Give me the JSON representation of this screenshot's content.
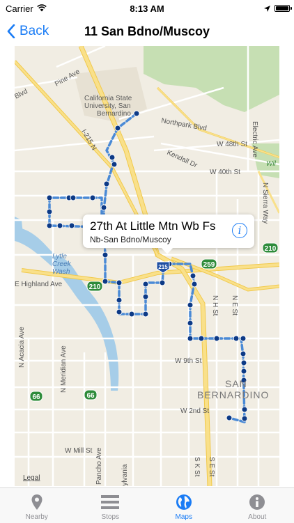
{
  "status_bar": {
    "carrier": "Carrier",
    "time": "8:13 AM",
    "battery_level": 1.0
  },
  "nav": {
    "back_label": "Back",
    "title": "11 San Bdno/Muscoy"
  },
  "map": {
    "labels": {
      "pine_ave": "Pine Ave",
      "csu": "California State",
      "csu2": "University, San",
      "csu3": "Bernardino",
      "northpark": "Northpark Blvd",
      "w48": "W 48th St",
      "w40": "W 40th St",
      "kendall": "Kendall Dr",
      "electric": "Electric Ave",
      "i215": "I-215 N",
      "sierra": "N Sierra Way",
      "lytle1": "Lytle",
      "lytle2": "Creek",
      "lytle3": "Wash",
      "highland": "E Highland Ave",
      "nh": "N H St",
      "ne": "N E St",
      "w9": "W 9th St",
      "san_bern1": "SAN",
      "san_bern2": "BERNARDINO",
      "w2": "W 2nd St",
      "mill": "W Mill St",
      "acacia": "N Acacia Ave",
      "meridian": "N Meridian Ave",
      "pancho": "Pancho Ave",
      "pennsylvania": "Pennsylvania",
      "sk": "S K St",
      "se": "S E St",
      "blvd": "Blvd",
      "wil": "Wil",
      "r210a": "210",
      "r210b": "210",
      "r259": "259",
      "r66a": "66",
      "r66b": "66",
      "r215": "215"
    },
    "legal": "Legal"
  },
  "callout": {
    "title": "27th At Little Mtn Wb Fs",
    "subtitle": "Nb-San Bdno/Muscoy"
  },
  "tabs": [
    {
      "label": "Nearby",
      "icon": "location-pin-icon",
      "active": false
    },
    {
      "label": "Stops",
      "icon": "list-icon",
      "active": false
    },
    {
      "label": "Maps",
      "icon": "globe-icon",
      "active": true
    },
    {
      "label": "About",
      "icon": "info-icon",
      "active": false
    }
  ],
  "colors": {
    "accent": "#1a7cf5",
    "route": "#4a8ad6",
    "stop": "#0d3a86",
    "freeway": "#f6d35e",
    "water": "#a6cde8",
    "park": "#c6dfb3"
  }
}
